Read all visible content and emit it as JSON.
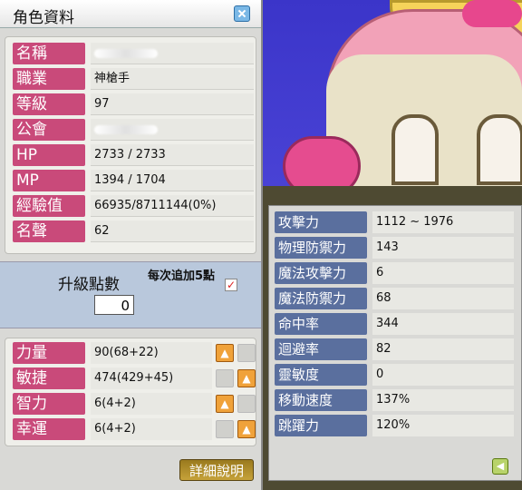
{
  "window": {
    "title": "角色資料"
  },
  "info_rows": [
    {
      "label": "名稱",
      "value": ""
    },
    {
      "label": "職業",
      "value": "神槍手"
    },
    {
      "label": "等級",
      "value": "97"
    },
    {
      "label": "公會",
      "value": ""
    },
    {
      "label": "HP",
      "value": "2733 / 2733"
    },
    {
      "label": "MP",
      "value": "1394 / 1704"
    },
    {
      "label": "經驗值",
      "value": "66935/8711144(0%)"
    },
    {
      "label": "名聲",
      "value": "62"
    }
  ],
  "level_up": {
    "label": "升級點數",
    "points": "0",
    "auto_label": "每次追加5點",
    "auto_checked": true
  },
  "attributes": [
    {
      "label": "力量",
      "value": "90(68+22)"
    },
    {
      "label": "敏捷",
      "value": "474(429+45)"
    },
    {
      "label": "智力",
      "value": "6(4+2)"
    },
    {
      "label": "幸運",
      "value": "6(4+2)"
    }
  ],
  "detail_button": "詳細說明",
  "details": [
    {
      "label": "攻擊力",
      "value": "1112 ~ 1976"
    },
    {
      "label": "物理防禦力",
      "value": "143"
    },
    {
      "label": "魔法攻擊力",
      "value": "6"
    },
    {
      "label": "魔法防禦力",
      "value": "68"
    },
    {
      "label": "命中率",
      "value": "344"
    },
    {
      "label": "迴避率",
      "value": "82"
    },
    {
      "label": "靈敏度",
      "value": "0"
    },
    {
      "label": "移動速度",
      "value": "137%"
    },
    {
      "label": "跳躍力",
      "value": "120%"
    }
  ],
  "colors": {
    "label_pink": "#c94a7a",
    "label_blue": "#5a6f9e",
    "level_bar": "#b9c8dc"
  }
}
